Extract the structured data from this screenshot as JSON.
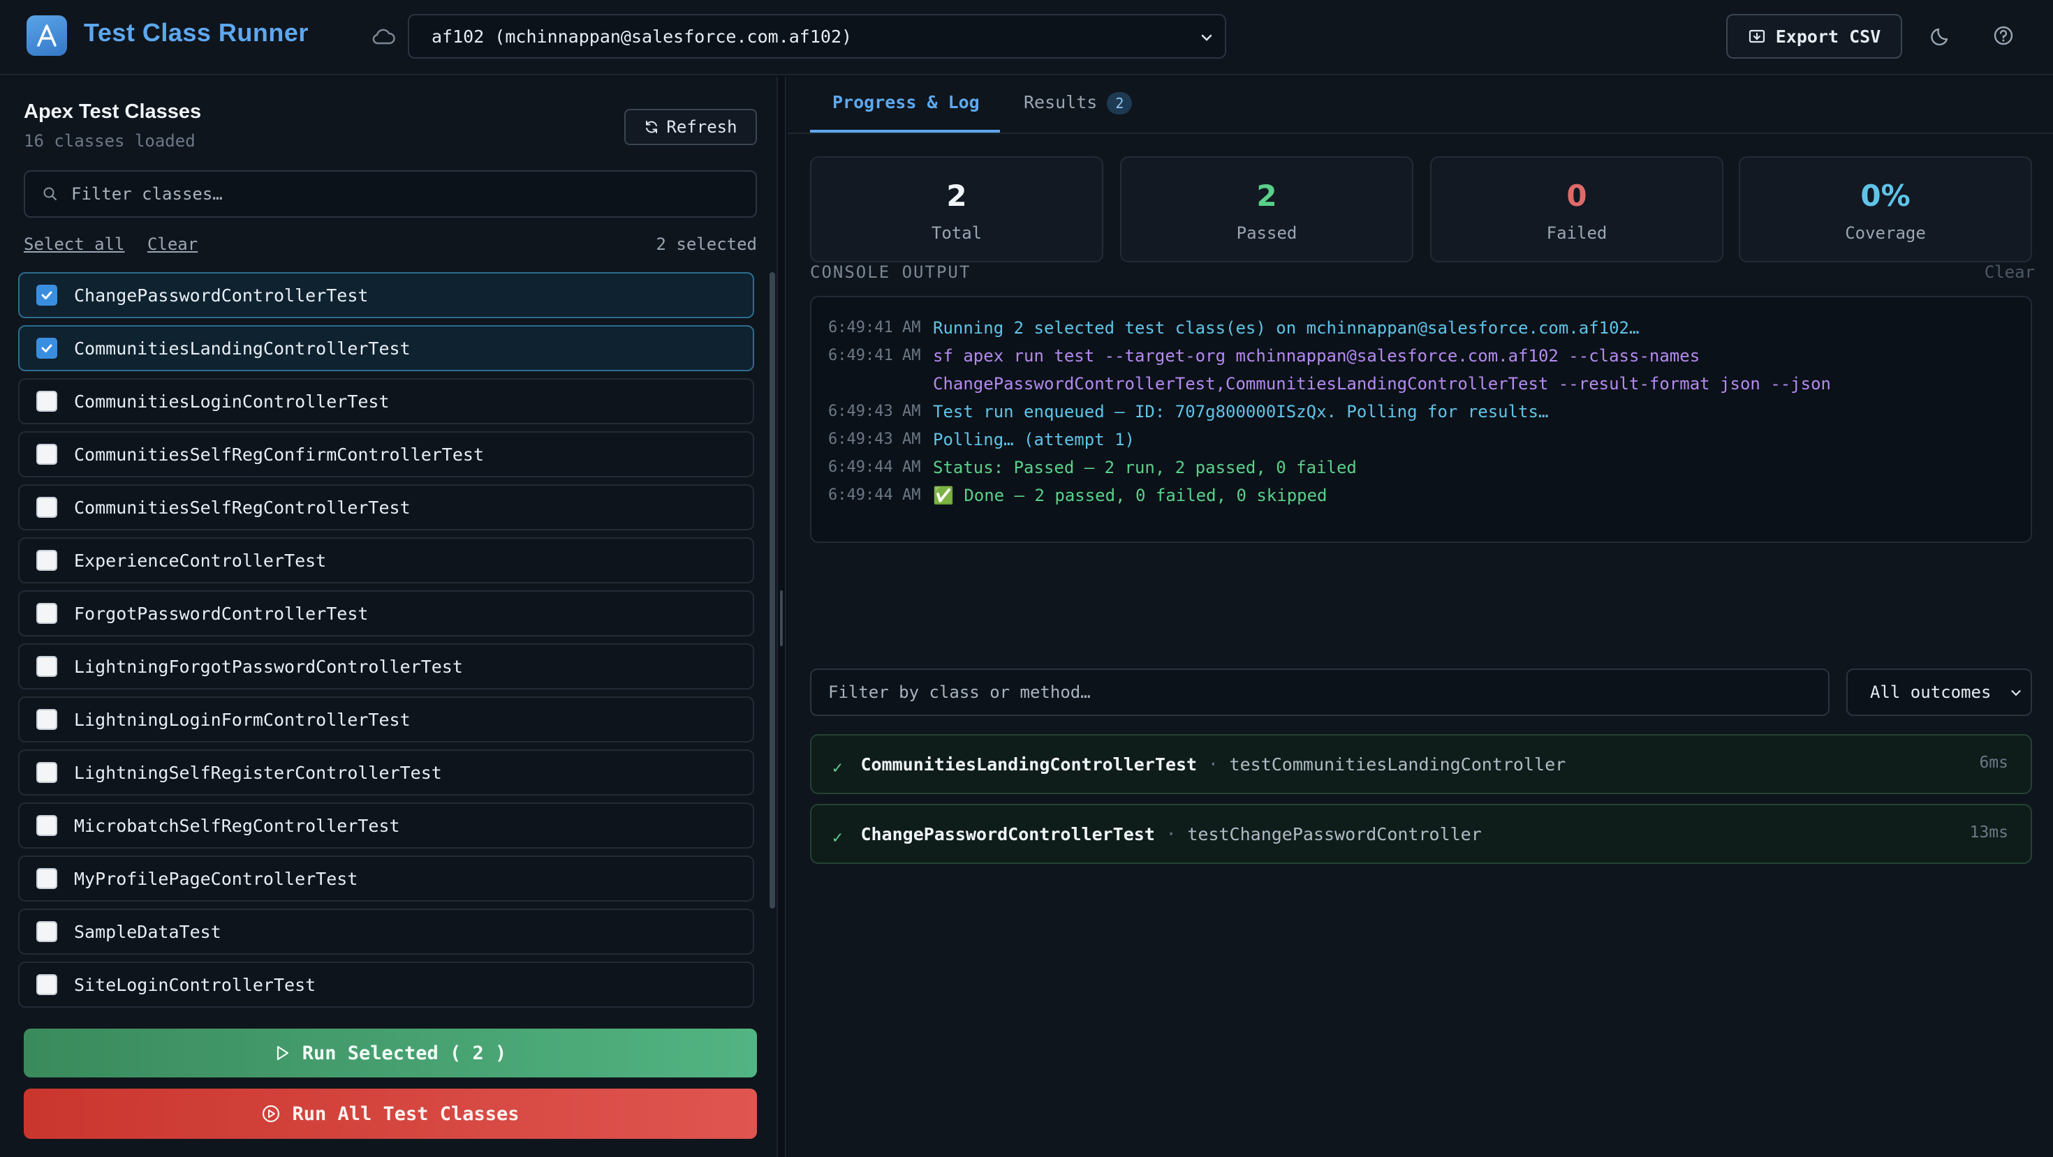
{
  "header": {
    "app_title": "Test Class Runner",
    "org_select_value": "af102 (mchinnappan@salesforce.com.af102)",
    "export_label": "Export CSV",
    "logo_letter": "A"
  },
  "left_panel": {
    "title": "Apex Test Classes",
    "subtitle": "16 classes loaded",
    "refresh_label": "Refresh",
    "filter_placeholder": "Filter classes…",
    "select_all_label": "Select all",
    "clear_label": "Clear",
    "selected_count": "2 selected",
    "classes": [
      {
        "name": "ChangePasswordControllerTest",
        "checked": true
      },
      {
        "name": "CommunitiesLandingControllerTest",
        "checked": true
      },
      {
        "name": "CommunitiesLoginControllerTest",
        "checked": false
      },
      {
        "name": "CommunitiesSelfRegConfirmControllerTest",
        "checked": false
      },
      {
        "name": "CommunitiesSelfRegControllerTest",
        "checked": false
      },
      {
        "name": "ExperienceControllerTest",
        "checked": false
      },
      {
        "name": "ForgotPasswordControllerTest",
        "checked": false
      },
      {
        "name": "LightningForgotPasswordControllerTest",
        "checked": false
      },
      {
        "name": "LightningLoginFormControllerTest",
        "checked": false
      },
      {
        "name": "LightningSelfRegisterControllerTest",
        "checked": false
      },
      {
        "name": "MicrobatchSelfRegControllerTest",
        "checked": false
      },
      {
        "name": "MyProfilePageControllerTest",
        "checked": false
      },
      {
        "name": "SampleDataTest",
        "checked": false
      },
      {
        "name": "SiteLoginControllerTest",
        "checked": false
      }
    ],
    "run_selected_label": "Run Selected ( 2 )",
    "run_all_label": "Run All Test Classes"
  },
  "right_panel": {
    "tabs": {
      "progress": "Progress & Log",
      "results": "Results",
      "results_badge": "2"
    },
    "stats": {
      "total": {
        "value": "2",
        "label": "Total"
      },
      "passed": {
        "value": "2",
        "label": "Passed"
      },
      "failed": {
        "value": "0",
        "label": "Failed"
      },
      "coverage": {
        "value": "0%",
        "label": "Coverage"
      }
    },
    "console": {
      "heading": "CONSOLE OUTPUT",
      "clear_label": "Clear",
      "lines": [
        {
          "time": "6:49:41 AM",
          "text": "Running 2 selected test class(es) on mchinnappan@salesforce.com.af102…",
          "kind": "info"
        },
        {
          "time": "6:49:41 AM",
          "text": "sf apex run test --target-org mchinnappan@salesforce.com.af102 --class-names",
          "text2": "ChangePasswordControllerTest,CommunitiesLandingControllerTest --result-format json --json",
          "kind": "cmd"
        },
        {
          "time": "6:49:43 AM",
          "text": "Test run enqueued — ID: 707g800000ISzQx. Polling for results…",
          "kind": "info"
        },
        {
          "time": "6:49:43 AM",
          "text": "Polling… (attempt 1)",
          "kind": "info"
        },
        {
          "time": "6:49:44 AM",
          "text": "Status: Passed — 2 run, 2 passed, 0 failed",
          "kind": "ok"
        },
        {
          "time": "6:49:44 AM",
          "text": "✅ Done — 2 passed, 0 failed, 0 skipped",
          "kind": "ok"
        }
      ]
    },
    "results": {
      "filter_placeholder": "Filter by class or method…",
      "outcome_value": "All outcomes",
      "rows": [
        {
          "class": "CommunitiesLandingControllerTest",
          "method": "testCommunitiesLandingController",
          "time": "6ms",
          "status": "pass"
        },
        {
          "class": "ChangePasswordControllerTest",
          "method": "testChangePasswordController",
          "time": "13ms",
          "status": "pass"
        }
      ]
    }
  },
  "colors": {
    "accent": "#5ea8ef",
    "pass": "#5ad08a",
    "fail": "#e06a6a",
    "coverage": "#5fc4e8"
  }
}
